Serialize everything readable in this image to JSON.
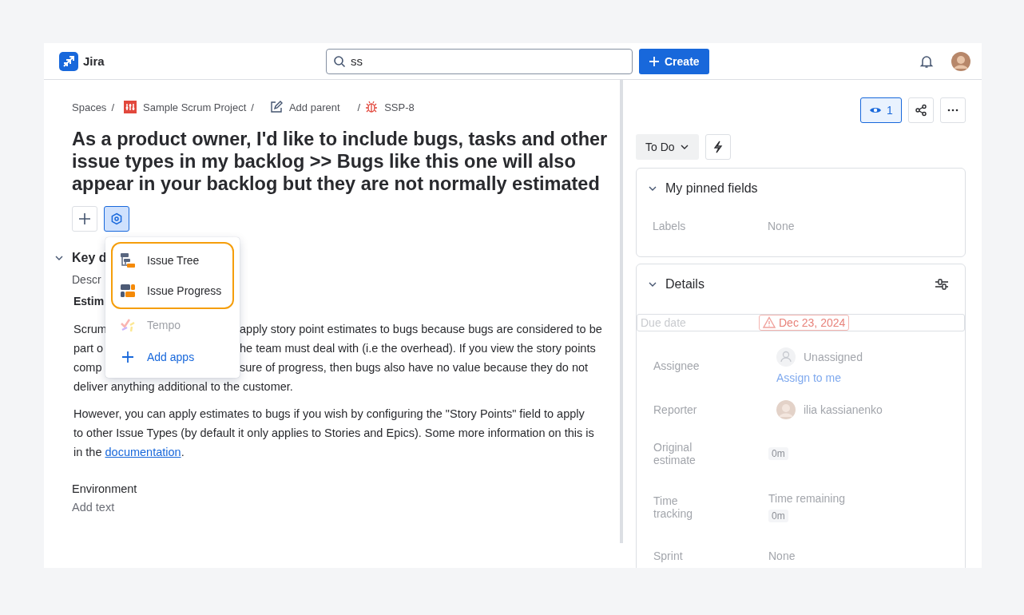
{
  "header": {
    "logo_text": "Jira",
    "search": {
      "value": "ss"
    },
    "create_button": "Create"
  },
  "breadcrumbs": [
    {
      "label": "Spaces",
      "kind": "text"
    },
    {
      "label": "Sample Scrum Project",
      "kind": "project"
    },
    {
      "label": "Add parent",
      "kind": "edit"
    },
    {
      "label": "SSP-8",
      "kind": "bug"
    }
  ],
  "breadcrumb_separator": "/",
  "title": "As a product owner, I'd like to include bugs, tasks and other issue types in my backlog >> Bugs like this one will also appear in your backlog but they are not normally estimated",
  "toolbar": [
    {
      "kind": "add",
      "selected": false
    },
    {
      "kind": "apps",
      "selected": true
    }
  ],
  "apps_menu": {
    "items": [
      {
        "label": "Issue Tree",
        "kind": "tree",
        "highlighted": true,
        "disabled": false
      },
      {
        "label": "Issue Progress",
        "kind": "progress",
        "highlighted": true,
        "disabled": false
      },
      {
        "label": "Tempo",
        "kind": "tempo",
        "highlighted": false,
        "disabled": true
      },
      {
        "label": "Add apps",
        "kind": "add",
        "highlighted": false,
        "disabled": false
      }
    ]
  },
  "key_details": {
    "heading": "Key d",
    "expanded": true
  },
  "description_label": "Descr",
  "estimation_heading": "Estim",
  "paragraph_lines": [
    {
      "left": "Scrum",
      "right": "apply story point estimates to bugs because bugs are considered to be"
    },
    {
      "left": "part o",
      "right": "he team must deal with (i.e the overhead). If you view the story points"
    },
    {
      "left": "comp",
      "right": "sure of progress, then bugs also have no value because they do not"
    },
    {
      "left": "deliver anything additional to the customer."
    }
  ],
  "paragraph2": {
    "before": "However, you can apply estimates to bugs if you wish by configuring the \"Story Points\" field to apply to other Issue Types (by default it only applies to Stories and Epics). Some more information on this is in the ",
    "link": "documentation",
    "after": "."
  },
  "environment": {
    "label": "Environment",
    "placeholder": "Add text"
  },
  "watchers": {
    "count": "1",
    "watching": true
  },
  "status": "To Do",
  "pinned": {
    "title": "My pinned fields",
    "expanded": true,
    "fields": [
      {
        "label": "Labels",
        "value": "None",
        "kind": "text"
      }
    ]
  },
  "details": {
    "title": "Details",
    "expanded": true,
    "fields": [
      {
        "label": "Due date",
        "kind": "date",
        "value": "Dec 23, 2024",
        "overdue": true
      },
      {
        "label": "Assignee",
        "kind": "user",
        "value": "Unassigned",
        "link": "Assign to me",
        "has_photo": false
      },
      {
        "label": "Reporter",
        "kind": "user",
        "value": "ilia kassianenko",
        "has_photo": true
      },
      {
        "label": "Original estimate",
        "kind": "estimate",
        "value": "0m"
      },
      {
        "label": "Time tracking",
        "kind": "time_tracking",
        "value": "Time remaining",
        "badge": "0m"
      },
      {
        "label": "Sprint",
        "kind": "text",
        "value": "None"
      }
    ]
  }
}
